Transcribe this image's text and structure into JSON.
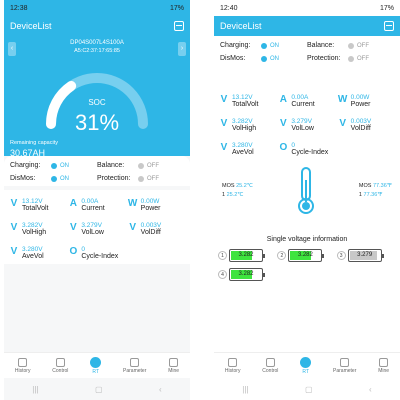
{
  "left": {
    "status": {
      "time": "12:38",
      "battery": "17%"
    },
    "app_title": "DeviceList",
    "device_name": "DP04S007L4S100A",
    "mac": "A5:C2:37:17:65:85",
    "soc_label": "SOC",
    "soc_value": "31%",
    "soc_fraction": 0.31,
    "remaining_label": "Remaining capacity",
    "remaining_value": "30.67AH",
    "toggles": [
      {
        "label": "Charging:",
        "state": "ON"
      },
      {
        "label": "Balance:",
        "state": "OFF"
      },
      {
        "label": "DisMos:",
        "state": "ON"
      },
      {
        "label": "Protection:",
        "state": "OFF"
      }
    ],
    "metrics": [
      {
        "icon": "V",
        "value": "13.12V",
        "label": "TotalVolt"
      },
      {
        "icon": "A",
        "value": "0.00A",
        "label": "Current"
      },
      {
        "icon": "W",
        "value": "0.00W",
        "label": "Power"
      },
      {
        "icon": "V",
        "value": "3.282V",
        "label": "VolHigh"
      },
      {
        "icon": "V",
        "value": "3.279V",
        "label": "VolLow"
      },
      {
        "icon": "V",
        "value": "0.003V",
        "label": "VolDiff"
      },
      {
        "icon": "V",
        "value": "3.280V",
        "label": "AveVol"
      },
      {
        "icon": "O",
        "value": "0",
        "label": "Cycle-Index"
      }
    ]
  },
  "right": {
    "status": {
      "time": "12:40",
      "battery": "17%"
    },
    "app_title": "DeviceList",
    "toggles": [
      {
        "label": "Charging:",
        "state": "ON"
      },
      {
        "label": "Balance:",
        "state": "OFF"
      },
      {
        "label": "DisMos:",
        "state": "ON"
      },
      {
        "label": "Protection:",
        "state": "OFF"
      }
    ],
    "metrics": [
      {
        "icon": "V",
        "value": "13.12V",
        "label": "TotalVolt"
      },
      {
        "icon": "A",
        "value": "0.00A",
        "label": "Current"
      },
      {
        "icon": "W",
        "value": "0.00W",
        "label": "Power"
      },
      {
        "icon": "V",
        "value": "3.282V",
        "label": "VolHigh"
      },
      {
        "icon": "V",
        "value": "3.279V",
        "label": "VolLow"
      },
      {
        "icon": "V",
        "value": "0.003V",
        "label": "VolDiff"
      },
      {
        "icon": "V",
        "value": "3.280V",
        "label": "AveVol"
      },
      {
        "icon": "O",
        "value": "0",
        "label": "Cycle-Index"
      }
    ],
    "temps_left": [
      {
        "name": "MOS",
        "value": "25.2℃"
      },
      {
        "name": "1",
        "value": "25.2℃"
      }
    ],
    "temps_right": [
      {
        "name": "MOS",
        "value": "77.36℉"
      },
      {
        "name": "1",
        "value": "77.36℉"
      }
    ],
    "single_voltage_title": "Single voltage information",
    "cells": [
      {
        "index": "1",
        "voltage": "3.282",
        "fill": 0.7,
        "color": "#3ee43e"
      },
      {
        "index": "2",
        "voltage": "3.282",
        "fill": 0.7,
        "color": "#3ee43e"
      },
      {
        "index": "3",
        "voltage": "3.279",
        "fill": 0.9,
        "color": "#c8c8c8"
      },
      {
        "index": "4",
        "voltage": "3.282",
        "fill": 0.7,
        "color": "#3ee43e"
      }
    ]
  },
  "tabs": [
    {
      "label": "History",
      "active": false
    },
    {
      "label": "Control",
      "active": false
    },
    {
      "label": "RT",
      "active": true
    },
    {
      "label": "Parameter",
      "active": false
    },
    {
      "label": "Mine",
      "active": false
    }
  ],
  "colors": {
    "accent": "#2eb6e6",
    "cell_green": "#3ee43e"
  }
}
